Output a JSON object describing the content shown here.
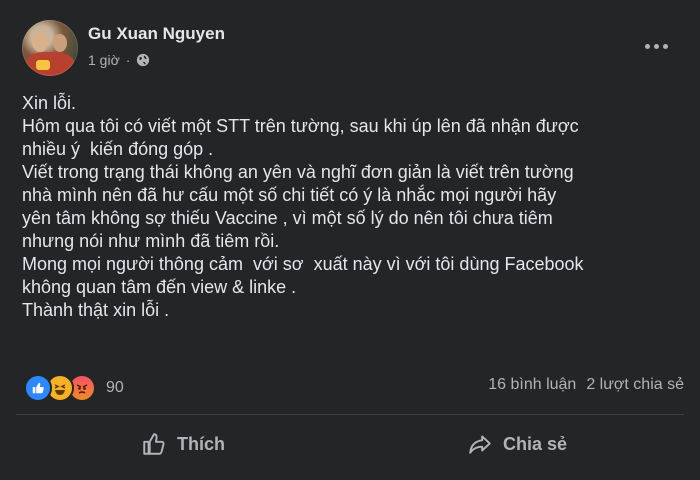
{
  "post": {
    "author": "Gu Xuan Nguyen",
    "time": "1 giờ",
    "privacy_icon": "globe-icon",
    "text_lines": [
      "Xin lỗi.",
      "Hôm qua tôi có viết một STT trên tường, sau khi úp lên đã nhận được",
      "nhiều ý  kiến đóng góp .",
      "Viết trong trạng thái không an yên và nghĩ đơn giản là viết trên tường",
      "nhà mình nên đã hư cấu một số chi tiết có ý là nhắc mọi người hãy",
      "yên tâm không sợ thiếu Vaccine , vì một số lý do nên tôi chưa tiêm",
      "nhưng nói như mình đã tiêm rồi.",
      "Mong mọi người thông cảm  với sơ  xuất này vì với tôi dùng Facebook",
      "không quan tâm đến view & linke .",
      "Thành thật xin lỗi ."
    ]
  },
  "reactions": {
    "icons": [
      "like-icon",
      "haha-icon",
      "angry-icon"
    ],
    "count": "90"
  },
  "stats": {
    "comments": "16 bình luận",
    "shares": "2 lượt chia sẻ"
  },
  "actions": {
    "like_label": "Thích",
    "share_label": "Chia sẻ"
  },
  "colors": {
    "background": "#242526",
    "text_primary": "#e4e6eb",
    "text_secondary": "#b0b3b8",
    "like_blue": "#2d88ff"
  }
}
